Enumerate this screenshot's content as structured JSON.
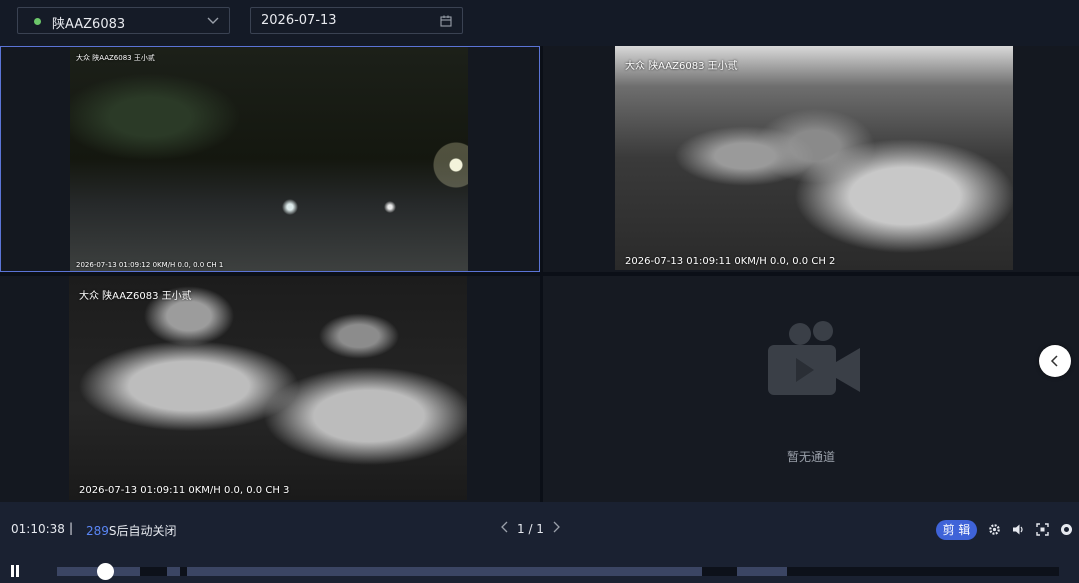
{
  "toolbar": {
    "vehicle": "陕AAZ6083",
    "vehicle_status_color": "#6cc76a",
    "date": "2026-07-13"
  },
  "channels": [
    {
      "header": "大众 陕AAZ6083 王小贰",
      "footer": "2026-07-13 01:09:12 0KM/H 0.0, 0.0 CH 1"
    },
    {
      "header": "大众 陕AAZ6083 王小贰",
      "footer": "2026-07-13 01:09:11 0KM/H 0.0, 0.0 CH 2"
    },
    {
      "header": "大众 陕AAZ6083 王小贰",
      "footer": "2026-07-13 01:09:11 0KM/H 0.0, 0.0 CH 3"
    },
    {
      "empty_text": "暂无通道",
      "icon": "video-camera-icon"
    }
  ],
  "controls": {
    "time": "01:10:38",
    "separator": "|",
    "countdown_number": "289",
    "countdown_suffix": "S后自动关闭",
    "page": "1 / 1",
    "edit_label": "剪 辑",
    "accent_color": "#3f63d8",
    "icons": [
      "settings-icon",
      "volume-icon",
      "fullscreen-icon",
      "snapshot-icon"
    ]
  },
  "playback": {
    "state": "playing",
    "progress": 0.05
  }
}
